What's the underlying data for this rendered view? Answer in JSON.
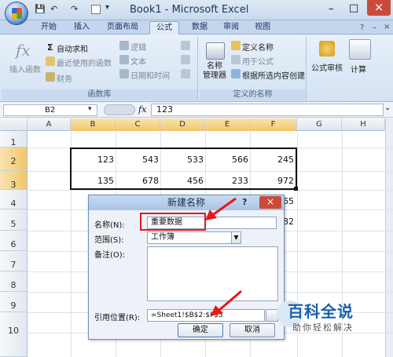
{
  "window": {
    "title": "Book1 - Microsoft Excel",
    "minimize": "–",
    "restore": "□",
    "close": "×"
  },
  "qat": {
    "save": "💾",
    "undo": "↶",
    "redo": "↷"
  },
  "tabs": [
    {
      "label": "开始"
    },
    {
      "label": "插入"
    },
    {
      "label": "页面布局"
    },
    {
      "label": "公式"
    },
    {
      "label": "数据"
    },
    {
      "label": "审阅"
    },
    {
      "label": "视图"
    }
  ],
  "ribbon": {
    "insert_function": "插入函数",
    "autosum": "自动求和",
    "recent": "最近使用的函数",
    "financial": "财务",
    "logical": "逻辑",
    "text": "文本",
    "datetime": "日期和时间",
    "function_library": "函数库",
    "name_manager": "名称\n管理器",
    "define_name": "定义名称",
    "use_in_formula": "用于公式",
    "create_from_selection": "根据所选内容创建",
    "defined_names": "定义的名称",
    "formula_auditing": "公式审核",
    "calculation": "计算"
  },
  "formula_bar": {
    "name_box": "B2",
    "fx": "fx",
    "value": "123"
  },
  "sheet": {
    "columns": [
      "A",
      "B",
      "C",
      "D",
      "E",
      "F",
      "G",
      "H"
    ],
    "rows": [
      "1",
      "2",
      "3",
      "4",
      "5",
      "6",
      "7",
      "8",
      "9",
      "10"
    ],
    "row2": [
      "123",
      "543",
      "533",
      "566",
      "245"
    ],
    "row3": [
      "135",
      "678",
      "456",
      "233",
      "972"
    ],
    "partial_f4": "65",
    "partial_f5": "82"
  },
  "dialog": {
    "title": "新建名称",
    "help": "?",
    "close": "×",
    "name_label": "名称(N):",
    "name_value": "重要数据",
    "scope_label": "范围(S):",
    "scope_value": "工作簿",
    "comment_label": "备注(O):",
    "refers_label": "引用位置(R):",
    "refers_value": "=Sheet1!$B$2:$F$3",
    "ok": "确定",
    "cancel": "取消"
  },
  "watermark": {
    "title": "百科全说",
    "subtitle": "助你轻松解决"
  },
  "colors": {
    "highlight": "#e8171c",
    "accent": "#1a5fa8"
  }
}
